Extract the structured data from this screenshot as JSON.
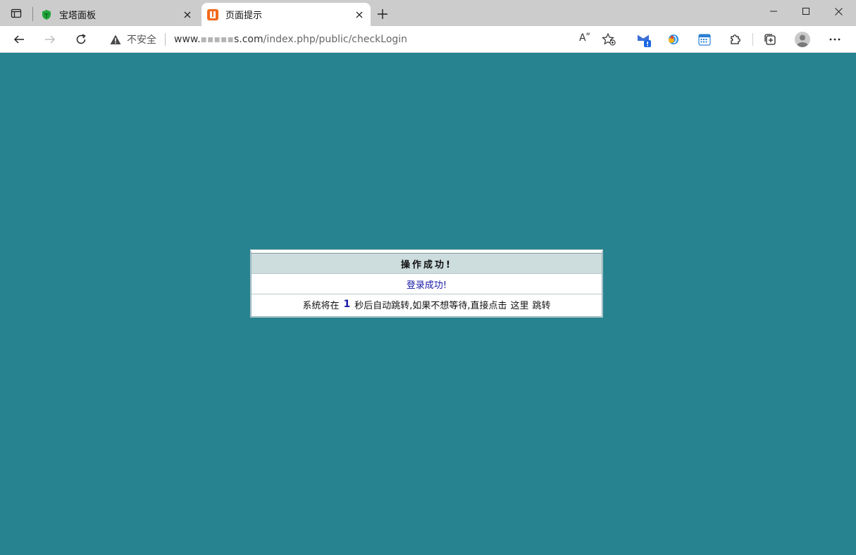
{
  "browser": {
    "tabs": [
      {
        "title": "宝塔面板",
        "active": false,
        "favicon": "baota-shield-icon"
      },
      {
        "title": "页面提示",
        "active": true,
        "favicon": "orange-page-icon"
      }
    ],
    "new_tab_icon": "plus-icon",
    "window_controls": [
      "minimize-icon",
      "maximize-icon",
      "close-icon"
    ],
    "address_bar": {
      "security_label": "不安全",
      "url_prefix": "www.",
      "url_blurred": "▪▪▪▪▪",
      "url_suffix": "s.com",
      "url_path": "/index.php/public/checkLogin",
      "read_aloud_label": "Aʺ"
    },
    "extensions": [
      "mail-badge-icon",
      "browser-ext-icon",
      "calendar-icon",
      "puzzle-icon",
      "collections-icon",
      "profile-avatar-icon",
      "more-icon"
    ]
  },
  "page": {
    "background": "#26838f",
    "message_box": {
      "heading": "操作成功!",
      "message": "登录成功!",
      "redirect_prefix": "系统将在",
      "countdown": "1",
      "redirect_middle": "秒后自动跳转,如果不想等待,直接点击",
      "link_text": "这里",
      "redirect_suffix": "跳转"
    }
  }
}
